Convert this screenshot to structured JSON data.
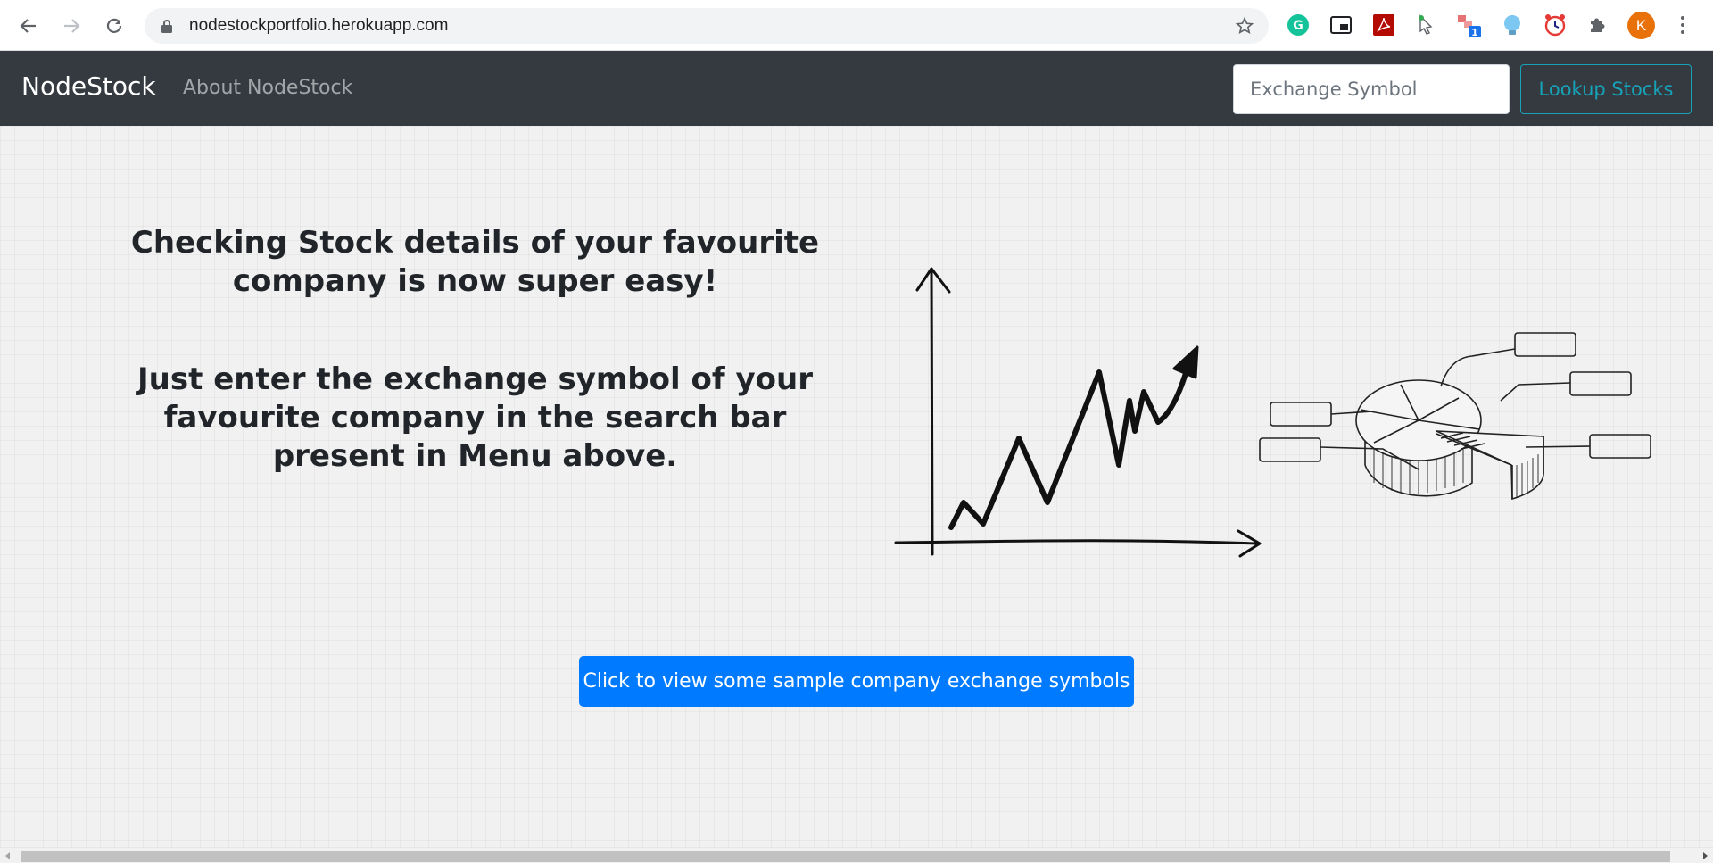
{
  "browser": {
    "url": "nodestockportfolio.herokuapp.com",
    "profile_initial": "K",
    "extension_badge": "1",
    "icons": [
      "back-arrow-icon",
      "forward-arrow-icon",
      "reload-icon",
      "lock-icon",
      "star-icon",
      "grammarly-icon",
      "picture-in-picture-icon",
      "pdf-icon",
      "cursor-extension-icon",
      "ext-badge-icon",
      "lightbulb-icon",
      "alarm-clock-icon",
      "puzzle-icon",
      "kebab-menu-icon"
    ]
  },
  "navbar": {
    "brand": "NodeStock",
    "about_link": "About NodeStock",
    "search_placeholder": "Exchange Symbol",
    "lookup_button": "Lookup Stocks"
  },
  "hero": {
    "headline": "Checking Stock details of your favourite company is now super easy!",
    "instruction": "Just enter the exchange symbol of your favourite company in the search bar present in Menu above.",
    "cta_button": "Click to view some sample company exchange symbols"
  },
  "colors": {
    "navbar_bg": "#343a40",
    "lookup_outline": "#17a2b8",
    "primary_button": "#007bff",
    "avatar": "#e8710a"
  }
}
